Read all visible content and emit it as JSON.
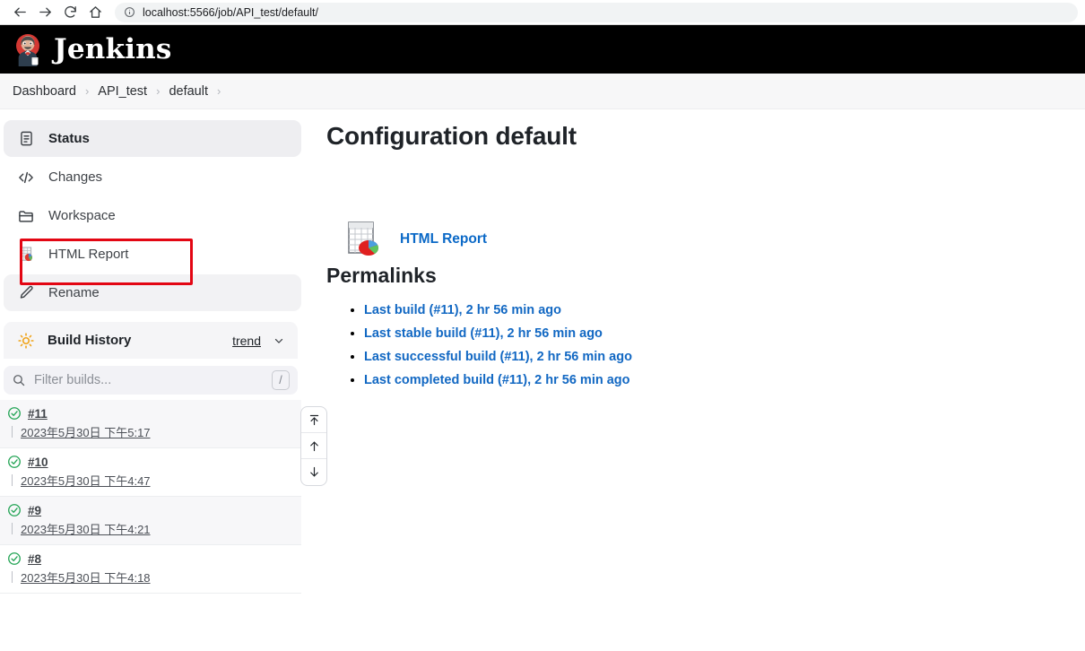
{
  "browser": {
    "url": "localhost:5566/job/API_test/default/",
    "back_label": "Back",
    "forward_label": "Forward",
    "reload_label": "Reload",
    "home_label": "Home",
    "info_label": "Site information"
  },
  "header": {
    "title": "Jenkins",
    "logo_name": "jenkins-butler-logo"
  },
  "breadcrumb": {
    "items": [
      {
        "label": "Dashboard"
      },
      {
        "label": "API_test"
      },
      {
        "label": "default"
      }
    ],
    "separator": "›"
  },
  "sidebar": {
    "items": [
      {
        "label": "Status",
        "icon": "document-icon",
        "state": "active"
      },
      {
        "label": "Changes",
        "icon": "code-icon",
        "state": "normal"
      },
      {
        "label": "Workspace",
        "icon": "folder-icon",
        "state": "normal"
      },
      {
        "label": "HTML Report",
        "icon": "html-report-icon",
        "state": "highlighted"
      },
      {
        "label": "Rename",
        "icon": "pencil-icon",
        "state": "shaded"
      }
    ],
    "annotation_color": "#e30613"
  },
  "build_history": {
    "title": "Build History",
    "icon": "weather-sun-icon",
    "trend_label": "trend",
    "chevron_icon": "chevron-down-icon",
    "filter": {
      "placeholder": "Filter builds...",
      "value": "",
      "shortcut": "/",
      "icon": "search-icon"
    },
    "scroll_controls": [
      {
        "name": "scroll-to-top-button",
        "icon": "arrow-to-top-icon"
      },
      {
        "name": "scroll-up-button",
        "icon": "arrow-up-icon"
      },
      {
        "name": "scroll-down-button",
        "icon": "arrow-down-icon"
      }
    ],
    "builds": [
      {
        "number": "#11",
        "timestamp": "2023年5月30日 下午5:17",
        "status": "success"
      },
      {
        "number": "#10",
        "timestamp": "2023年5月30日 下午4:47",
        "status": "success"
      },
      {
        "number": "#9",
        "timestamp": "2023年5月30日 下午4:21",
        "status": "success"
      },
      {
        "number": "#8",
        "timestamp": "2023年5月30日 下午4:18",
        "status": "success"
      }
    ],
    "status_color": "#23a455"
  },
  "main": {
    "title": "Configuration default",
    "report": {
      "label": "HTML Report",
      "icon": "spreadsheet-piechart-icon"
    },
    "permalinks_title": "Permalinks",
    "permalinks": [
      {
        "label": "Last build (#11), 2 hr 56 min ago"
      },
      {
        "label": "Last stable build (#11), 2 hr 56 min ago"
      },
      {
        "label": "Last successful build (#11), 2 hr 56 min ago"
      },
      {
        "label": "Last completed build (#11), 2 hr 56 min ago"
      }
    ],
    "link_color": "#1268c3"
  }
}
